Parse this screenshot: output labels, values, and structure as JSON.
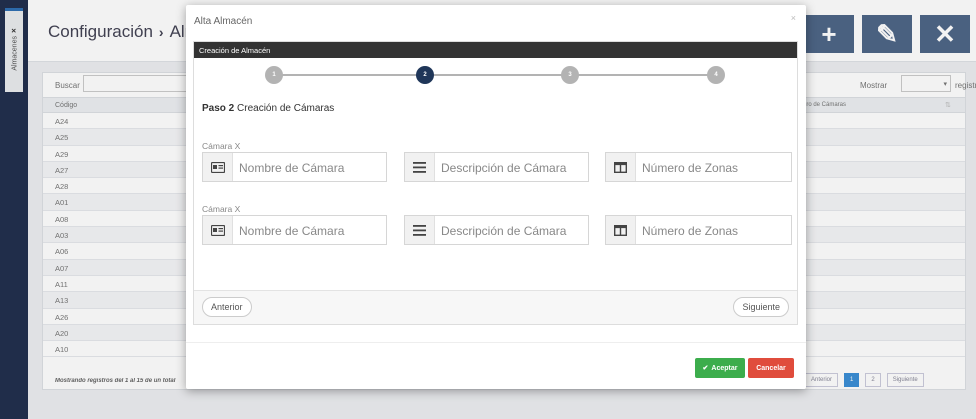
{
  "side_tab": {
    "label": "Almacenes",
    "close": "×"
  },
  "background": {
    "breadcrumb": {
      "part1": "Configuración",
      "separator": "›",
      "part2": "Almacen"
    },
    "actions": {
      "add": "+",
      "edit": "✎",
      "close": "✕"
    },
    "search_label": "Buscar",
    "show_label": "Mostrar",
    "show_after": "registros",
    "show_select_arrow": "▾",
    "columns": {
      "code": "Código",
      "cameras": "ero de Cámaras",
      "sort": "⇅"
    },
    "rows": [
      "A24",
      "A25",
      "A29",
      "A27",
      "A28",
      "A01",
      "A08",
      "A03",
      "A06",
      "A07",
      "A11",
      "A13",
      "A26",
      "A20",
      "A10"
    ],
    "footer_text": "Mostrando registros del 1 al 15 de un total",
    "pager": {
      "prev": "Anterior",
      "page1": "1",
      "page2": "2",
      "next": "Siguiente"
    }
  },
  "modal": {
    "title": "Alta Almacén",
    "close": "×",
    "wizard_title": "Creación de Almacén",
    "steps": [
      "1",
      "2",
      "3",
      "4"
    ],
    "active_step": 2,
    "heading_step": "Paso 2",
    "heading_text": "Creación de Cámaras",
    "cameras": [
      {
        "label": "Cámara X",
        "name_placeholder": "Nombre de Cámara",
        "desc_placeholder": "Descripción  de Cámara",
        "zones_placeholder": "Número de Zonas"
      },
      {
        "label": "Cámara X",
        "name_placeholder": "Nombre de Cámara",
        "desc_placeholder": "Descripción  de Cámara",
        "zones_placeholder": "Número de Zonas"
      }
    ],
    "prev_label": "Anterior",
    "next_label": "Siguiente",
    "accept_label": "Aceptar",
    "accept_icon": "✔",
    "cancel_label": "Cancelar"
  },
  "icons": {
    "name": "id-card-icon",
    "description": "align-justify-icon",
    "zones": "columns-icon"
  },
  "colors": {
    "primary": "#4f6787",
    "dark_nav": "#22304f",
    "step_active": "#1f3659",
    "accept": "#3cad4c",
    "cancel": "#e04c3c",
    "pager_active": "#3c8fd6"
  }
}
